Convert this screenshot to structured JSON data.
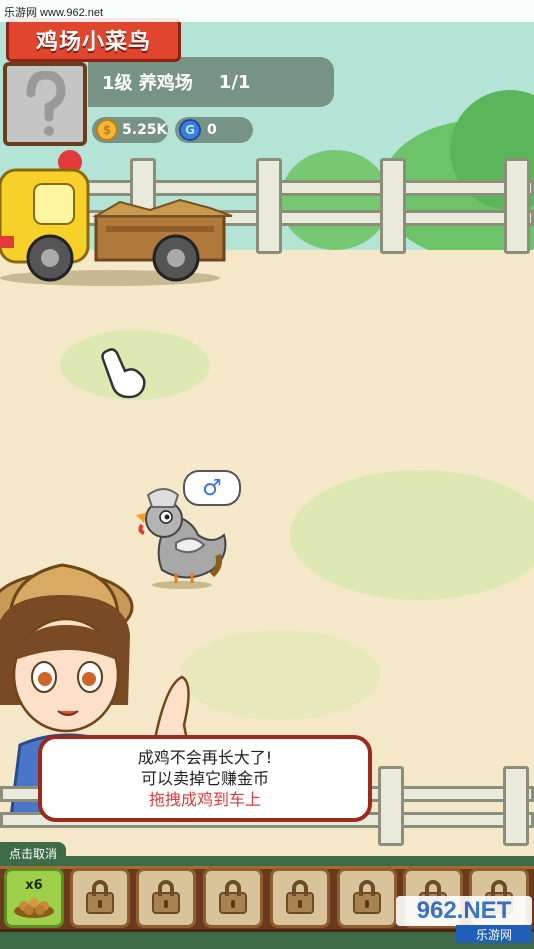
{
  "watermark": {
    "text": "乐游网 www.962.net"
  },
  "header": {
    "title": "鸡场小菜鸟",
    "level_text": "1级 养鸡场",
    "capacity": "1/1"
  },
  "currency": {
    "coins": "5.25K",
    "gems": "0",
    "coin_icon": "coin-icon",
    "gem_icon": "gem-icon"
  },
  "chicken": {
    "gender_symbol": "♂"
  },
  "dialog": {
    "line1": "成鸡不会再长大了!",
    "line2": "可以卖掉它赚金币",
    "hint": "拖拽成鸡到车上"
  },
  "bottom": {
    "cancel_label": "点击取消",
    "feed_count": "x6",
    "locked_slots": 7
  },
  "logo": {
    "main": "962.NET",
    "sub": "乐游网"
  },
  "colors": {
    "accent_red": "#e0452e",
    "dialog_border": "#9a2a1d",
    "hint_text": "#e23a3a",
    "slot_active": "#9ed149"
  }
}
